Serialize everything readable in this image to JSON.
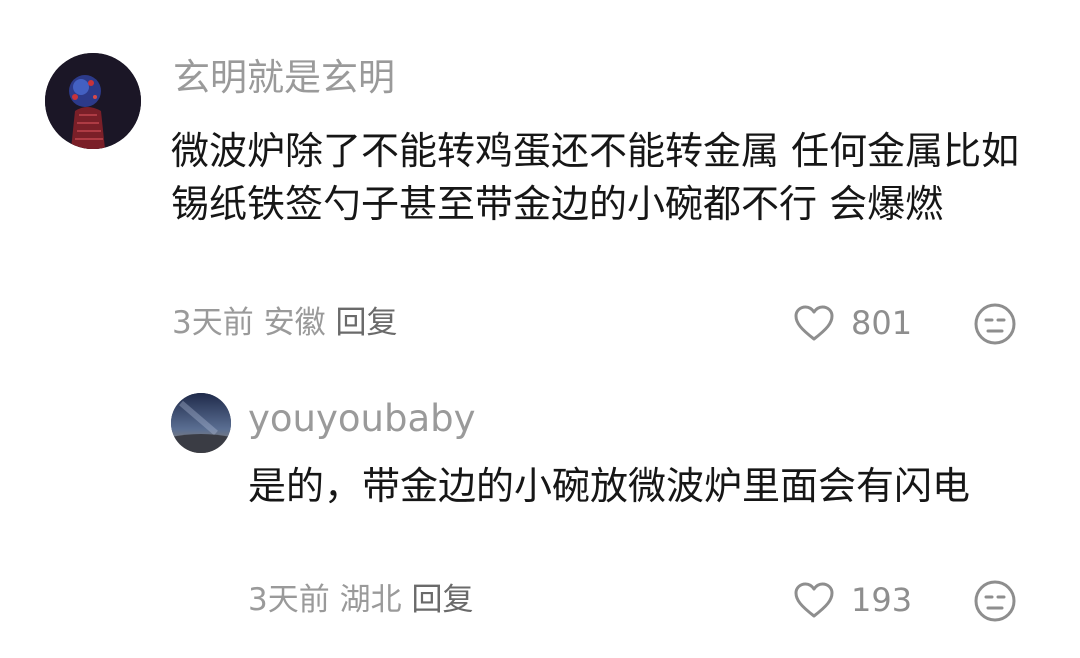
{
  "comments": [
    {
      "username": "玄明就是玄明",
      "text": "微波炉除了不能转鸡蛋还不能转金属 任何金属比如锡纸铁签勺子甚至带金边的小碗都不行 会爆燃",
      "time": "3天前",
      "location": "安徽",
      "reply_label": "回复",
      "like_count": "801",
      "like_icon": "heart-outline-icon",
      "reaction_icon": "neutral-face-icon"
    },
    {
      "username": "youyoubaby",
      "text": "是的，带金边的小碗放微波炉里面会有闪电",
      "time": "3天前",
      "location": "湖北",
      "reply_label": "回复",
      "like_count": "193",
      "like_icon": "heart-outline-icon",
      "reaction_icon": "neutral-face-icon"
    }
  ],
  "colors": {
    "username": "#9a9a9a",
    "body_text": "#161616",
    "meta_text": "#9a9a9a",
    "icon_stroke": "#8e8e8e"
  }
}
